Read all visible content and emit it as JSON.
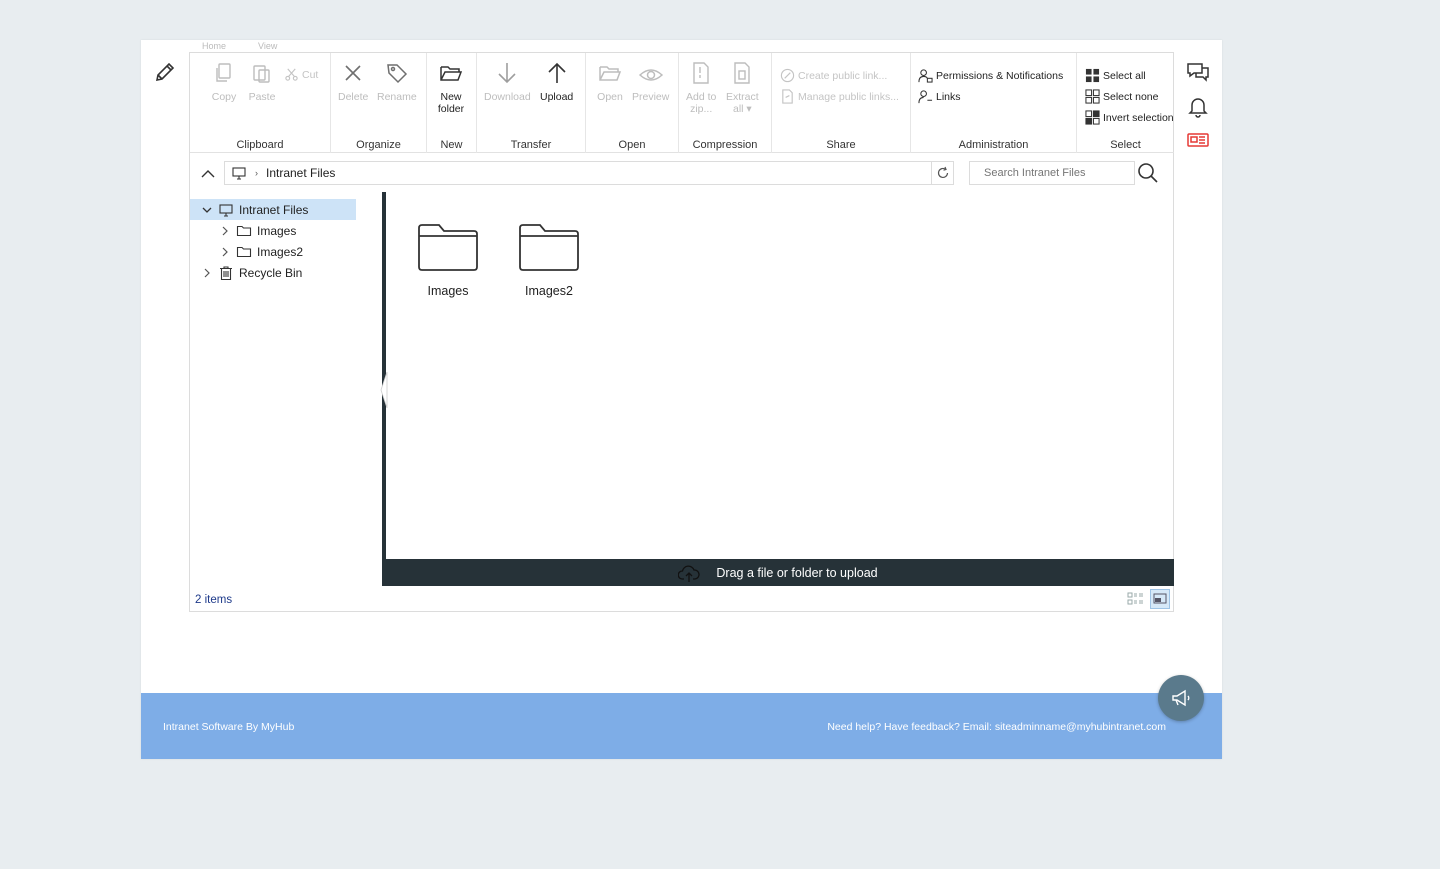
{
  "ribbon": {
    "tabs": [
      "Home",
      "View"
    ],
    "clipboard": {
      "title": "Clipboard",
      "copy": "Copy",
      "paste": "Paste",
      "cut": "Cut"
    },
    "organize": {
      "title": "Organize",
      "delete": "Delete",
      "rename": "Rename"
    },
    "new": {
      "title": "New",
      "new_folder_line1": "New",
      "new_folder_line2": "folder"
    },
    "transfer": {
      "title": "Transfer",
      "download": "Download",
      "upload": "Upload"
    },
    "open": {
      "title": "Open",
      "open": "Open",
      "preview": "Preview"
    },
    "compression": {
      "title": "Compression",
      "add_to_zip_line1": "Add to",
      "add_to_zip_line2": "zip...",
      "extract_line1": "Extract",
      "extract_line2": "all"
    },
    "share": {
      "title": "Share",
      "create_public_link": "Create public link...",
      "manage_public_links": "Manage public links..."
    },
    "administration": {
      "title": "Administration",
      "permissions": "Permissions & Notifications",
      "links": "Links"
    },
    "select": {
      "title": "Select",
      "select_all": "Select all",
      "select_none": "Select none",
      "invert_selection": "Invert selection"
    }
  },
  "address": {
    "path": "Intranet Files",
    "search_placeholder": "Search Intranet Files"
  },
  "tree": {
    "root": "Intranet Files",
    "children": [
      "Images",
      "Images2"
    ],
    "recycle_bin": "Recycle Bin"
  },
  "content": {
    "folders": [
      "Images",
      "Images2"
    ],
    "drop_hint": "Drag a file or folder to upload"
  },
  "status": {
    "item_count": "2 items"
  },
  "footer": {
    "left": "Intranet Software By MyHub",
    "right": "Need help? Have feedback? Email: siteadminname@myhubintranet.com"
  },
  "colors": {
    "accent": "#7eade7",
    "dark": "#263238",
    "selection": "#cde3f7",
    "alert": "#e53935"
  }
}
